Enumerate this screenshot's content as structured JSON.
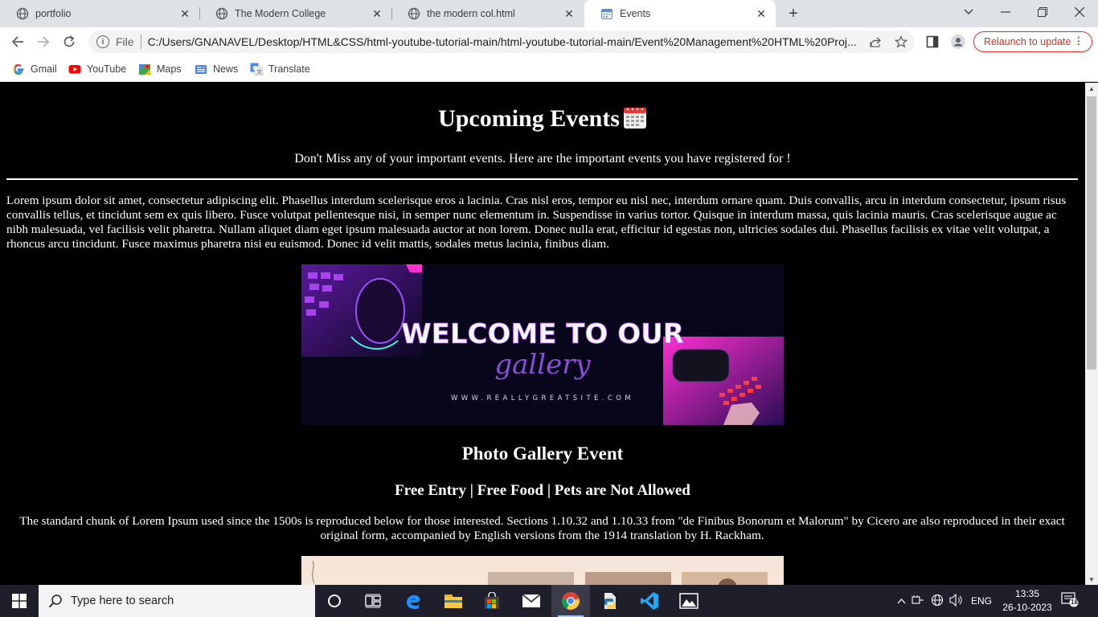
{
  "browser": {
    "tabs": [
      {
        "title": "portfolio"
      },
      {
        "title": "The Modern College"
      },
      {
        "title": "the modern col.html"
      },
      {
        "title": "Events"
      }
    ],
    "omnibox": {
      "file_label": "File",
      "url": "C:/Users/GNANAVEL/Desktop/HTML&CSS/html-youtube-tutorial-main/html-youtube-tutorial-main/Event%20Management%20HTML%20Proj..."
    },
    "relaunch_label": "Relaunch to update",
    "bookmarks": [
      {
        "label": "Gmail",
        "icon": "gmail-icon"
      },
      {
        "label": "YouTube",
        "icon": "youtube-icon"
      },
      {
        "label": "Maps",
        "icon": "maps-icon"
      },
      {
        "label": "News",
        "icon": "news-icon"
      },
      {
        "label": "Translate",
        "icon": "translate-icon"
      }
    ]
  },
  "page": {
    "heading": "Upcoming Events",
    "tagline": "Don't Miss any of your important events. Here are the important events you have registered for !",
    "intro_paragraph": "Lorem ipsum dolor sit amet, consectetur adipiscing elit. Phasellus interdum scelerisque eros a lacinia. Cras nisl eros, tempor eu nisl nec, interdum ornare quam. Duis convallis, arcu in interdum consectetur, ipsum risus convallis tellus, et tincidunt sem ex quis libero. Fusce volutpat pellentesque nisi, in semper nunc elementum in. Suspendisse in varius tortor. Quisque in interdum massa, quis lacinia mauris. Cras scelerisque augue ac nibh malesuada, vel facilisis velit pharetra. Nullam aliquet diam eget ipsum malesuada auctor at non lorem. Donec nulla erat, efficitur id egestas non, ultricies sodales dui. Phasellus facilisis ex vitae velit volutpat, a rhoncus arcu tincidunt. Fusce maximus pharetra nisi eu euismod. Donec id velit mattis, sodales metus lacinia, finibus diam.",
    "banner": {
      "line1": "WELCOME TO OUR",
      "line2": "gallery",
      "website": "WWW.REALLYGREATSITE.COM"
    },
    "event_title": "Photo Gallery Event",
    "event_subtitle": "Free Entry | Free Food | Pets are Not Allowed",
    "event_paragraph": "The standard chunk of Lorem Ipsum used since the 1500s is reproduced below for those interested. Sections 1.10.32 and 1.10.33 from \"de Finibus Bonorum et Malorum\" by Cicero are also reproduced in their exact original form, accompanied by English versions from the 1914 translation by H. Rackham."
  },
  "taskbar": {
    "search_placeholder": "Type here to search",
    "language": "ENG",
    "time": "13:35",
    "date": "26-10-2023",
    "notification_count": "18"
  },
  "colors": {
    "relaunch_red": "#d93025",
    "banner_purple": "#8a4fd6",
    "banner_pink": "#ff2fd0"
  }
}
